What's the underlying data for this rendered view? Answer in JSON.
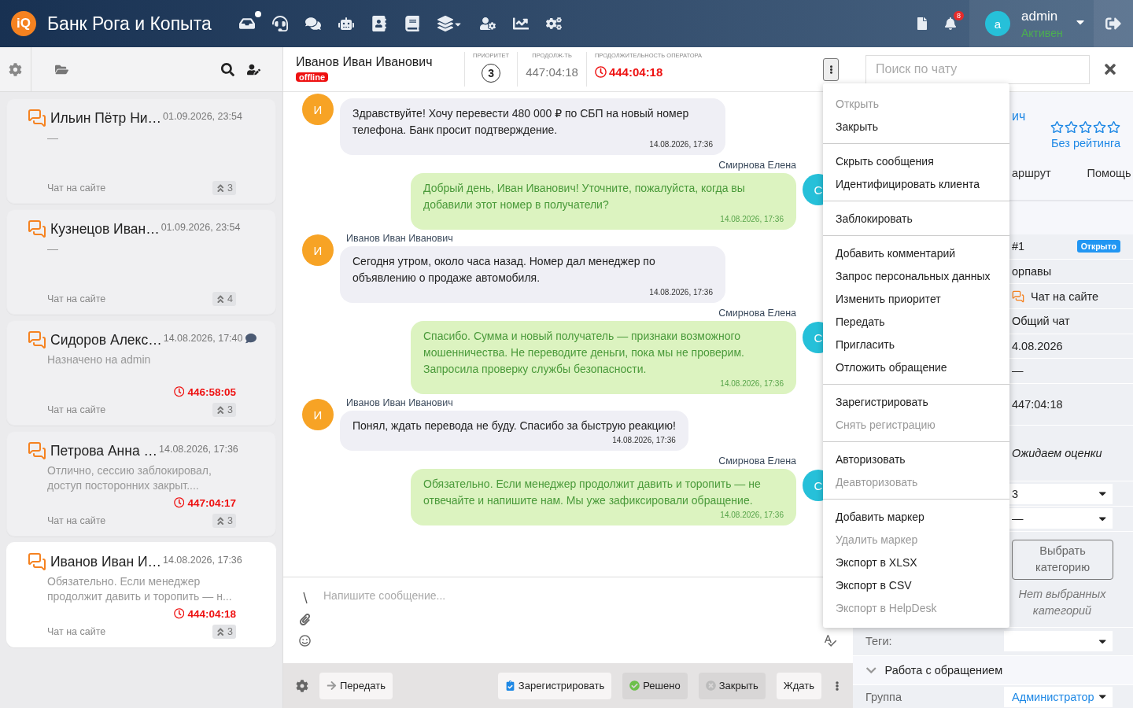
{
  "header": {
    "logo": "iQ",
    "title": "Банк Рога и Копыта",
    "notifications": "8",
    "user": {
      "avatar": "a",
      "name": "admin",
      "status": "Активен"
    }
  },
  "chat_list": {
    "items": [
      {
        "name": "Ильин Пётр Ни…",
        "time": "01.09.2026, 23:54",
        "preview": "—",
        "channel": "Чат на сайте",
        "priority": "3",
        "has_comment": false,
        "selected": false
      },
      {
        "name": "Кузнецов Иван…",
        "time": "01.09.2026, 23:54",
        "preview": "—",
        "channel": "Чат на сайте",
        "priority": "4",
        "has_comment": false,
        "selected": false
      },
      {
        "name": "Сидоров Алекс…",
        "time": "14.08.2026, 17:40",
        "preview": "Назначено на admin",
        "timer": "446:58:05",
        "channel": "Чат на сайте",
        "priority": "3",
        "has_comment": true,
        "selected": false
      },
      {
        "name": "Петрова Анна …",
        "time": "14.08.2026, 17:36",
        "preview": "Отлично, сессию заблокировал, доступ посторонних закрыт....",
        "timer": "447:04:17",
        "channel": "Чат на сайте",
        "priority": "3",
        "has_comment": false,
        "selected": false
      },
      {
        "name": "Иванов Иван И…",
        "time": "14.08.2026, 17:36",
        "preview": "Обязательно. Если менеджер продолжит давить и торопить — н...",
        "timer": "444:04:18",
        "channel": "Чат на сайте",
        "priority": "3",
        "has_comment": false,
        "selected": true
      }
    ]
  },
  "chat": {
    "name": "Иванов Иван Иванович",
    "status": "offline",
    "priority_label": "ПРИОРИТЕТ",
    "priority": "3",
    "duration_label": "ПРОДОЛЖ-ТЬ",
    "duration": "447:04:18",
    "operator_label": "ПРОДОЛЖИТЕЛЬНОСТЬ ОПЕРАТОРА",
    "operator_time": "444:04:18",
    "messages": [
      {
        "kind": "client",
        "avatar": "И",
        "text": "Здравствуйте! Хочу перевести 480 000 ₽ по СБП на новый номер телефона. Банк просит подтверждение.",
        "time": "14.08.2026, 17:36"
      },
      {
        "kind": "operator",
        "avatar": "С",
        "author": "Смирнова Елена",
        "text": "Добрый день, Иван Иванович! Уточните, пожалуйста, когда вы добавили этот номер в получатели?",
        "time": "14.08.2026, 17:36"
      },
      {
        "kind": "client",
        "avatar": "И",
        "author": "Иванов Иван Иванович",
        "text": "Сегодня утром, около часа назад. Номер дал менеджер по объявлению о продаже автомобиля.",
        "time": "14.08.2026, 17:36"
      },
      {
        "kind": "operator",
        "avatar": "С",
        "author": "Смирнова Елена",
        "text": "Спасибо. Сумма и новый получатель — признаки возможного мошенничества. Не переводите деньги, пока мы не проверим. Запросила проверку службы безопасности.",
        "time": "14.08.2026, 17:36"
      },
      {
        "kind": "client",
        "avatar": "И",
        "author": "Иванов Иван Иванович",
        "text": "Понял, ждать перевода не буду. Спасибо за быструю реакцию!",
        "time": "14.08.2026, 17:36"
      },
      {
        "kind": "operator",
        "avatar": "С",
        "author": "Смирнова Елена",
        "text": "Обязательно. Если менеджер продолжит давить и торопить — не отвечайте и напишите нам. Мы уже зафиксировали обращение.",
        "time": "14.08.2026, 17:36"
      }
    ],
    "composer": {
      "placeholder": "Напишите сообщение..."
    },
    "actions": [
      {
        "kind": "transfer",
        "label": "Передать"
      },
      {
        "kind": "register",
        "label": "Зарегистрировать"
      },
      {
        "kind": "resolved",
        "label": "Решено"
      },
      {
        "kind": "close",
        "label": "Закрыть"
      },
      {
        "kind": "wait",
        "label": "Ждать"
      }
    ]
  },
  "right_panel": {
    "search": {
      "placeholder": "Поиск по чату"
    },
    "client_name": "ич",
    "rating": {
      "stars": 0,
      "text": "Без рейтинга"
    },
    "tabs": [
      {
        "label": "аршрут",
        "selected": false
      },
      {
        "label": "Помощь",
        "selected": false
      }
    ],
    "rows": [
      {
        "kind": "badge",
        "value": "#1",
        "badge": "Открыто"
      },
      {
        "kind": "text",
        "value": "орпавы"
      },
      {
        "kind": "channel",
        "value": "Чат на сайте"
      },
      {
        "kind": "text",
        "value": "Общий чат"
      },
      {
        "kind": "text",
        "value": "4.08.2026"
      },
      {
        "kind": "text",
        "value": "—"
      },
      {
        "kind": "tall",
        "value": "447:04:18"
      },
      {
        "kind": "italic",
        "value": "Ожидаем оценки"
      },
      {
        "kind": "select",
        "value": "3"
      },
      {
        "kind": "select",
        "value": "—"
      }
    ],
    "category_button": "Выбрать категорию",
    "no_categories": "Нет выбранных категорий",
    "tags_label": "Теги:",
    "section": {
      "title": "Работа с обращением",
      "expanded": true
    },
    "group_label": "Группа",
    "group_value": "Администратор"
  },
  "menu": {
    "groups": [
      {
        "items": [
          {
            "label": "Открыть",
            "disabled": true
          },
          {
            "label": "Закрыть",
            "disabled": false
          }
        ]
      },
      {
        "items": [
          {
            "label": "Скрыть сообщения",
            "disabled": false
          },
          {
            "label": "Идентифицировать клиента",
            "disabled": false
          }
        ]
      },
      {
        "items": [
          {
            "label": "Заблокировать",
            "disabled": false
          }
        ]
      },
      {
        "items": [
          {
            "label": "Добавить комментарий",
            "disabled": false
          },
          {
            "label": "Запрос персональных данных",
            "disabled": false
          },
          {
            "label": "Изменить приоритет",
            "disabled": false
          },
          {
            "label": "Передать",
            "disabled": false
          },
          {
            "label": "Пригласить",
            "disabled": false
          },
          {
            "label": "Отложить обращение",
            "disabled": false
          }
        ]
      },
      {
        "items": [
          {
            "label": "Зарегистрировать",
            "disabled": false
          },
          {
            "label": "Снять регистрацию",
            "disabled": true
          }
        ]
      },
      {
        "items": [
          {
            "label": "Авторизовать",
            "disabled": false
          },
          {
            "label": "Деавторизовать",
            "disabled": true
          }
        ]
      },
      {
        "items": [
          {
            "label": "Добавить маркер",
            "disabled": false
          },
          {
            "label": "Удалить маркер",
            "disabled": true
          },
          {
            "label": "Экспорт в XLSX",
            "disabled": false
          },
          {
            "label": "Экспорт в CSV",
            "disabled": false
          },
          {
            "label": "Экспорт в HelpDesk",
            "disabled": true
          }
        ]
      }
    ]
  }
}
